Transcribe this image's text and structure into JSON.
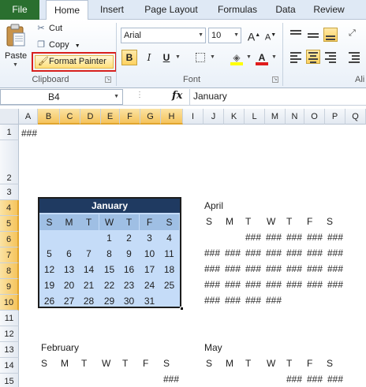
{
  "tabs": [
    "File",
    "Home",
    "Insert",
    "Page Layout",
    "Formulas",
    "Data",
    "Review"
  ],
  "clipboard": {
    "paste_label": "Paste",
    "cut_label": "Cut",
    "copy_label": "Copy",
    "format_painter_label": "Format Painter",
    "group_label": "Clipboard"
  },
  "font": {
    "name": "Arial",
    "size": "10",
    "group_label": "Font",
    "bold": "B",
    "italic": "I",
    "underline": "U",
    "grow": "A",
    "shrink": "A",
    "color_letter": "A"
  },
  "alignment": {
    "group_label": "Ali"
  },
  "formula_bar": {
    "name_box": "B4",
    "fx": "fx",
    "content": "January"
  },
  "columns": [
    "A",
    "B",
    "C",
    "D",
    "E",
    "F",
    "G",
    "H",
    "I",
    "J",
    "K",
    "L",
    "M",
    "N",
    "O",
    "P",
    "Q"
  ],
  "rows": [
    "1",
    "2",
    "3",
    "4",
    "5",
    "6",
    "7",
    "8",
    "9",
    "10",
    "11",
    "12",
    "13",
    "14",
    "15"
  ],
  "cells": {
    "a1": "###",
    "april_title": "April",
    "february_title": "February",
    "may_title": "May",
    "dow": [
      "S",
      "M",
      "T",
      "W",
      "T",
      "F",
      "S"
    ],
    "hash": "###"
  },
  "january": {
    "title": "January",
    "days": [
      [
        "",
        "",
        "",
        "1",
        "2",
        "3",
        "4"
      ],
      [
        "5",
        "6",
        "7",
        "8",
        "9",
        "10",
        "11"
      ],
      [
        "12",
        "13",
        "14",
        "15",
        "16",
        "17",
        "18"
      ],
      [
        "19",
        "20",
        "21",
        "22",
        "23",
        "24",
        "25"
      ],
      [
        "26",
        "27",
        "28",
        "29",
        "30",
        "31",
        ""
      ]
    ]
  },
  "colors": {
    "accent": "#1f3a61",
    "highlight": "#c5dcf8",
    "file_tab": "#2a6f2f",
    "callout": "#d8201d"
  }
}
